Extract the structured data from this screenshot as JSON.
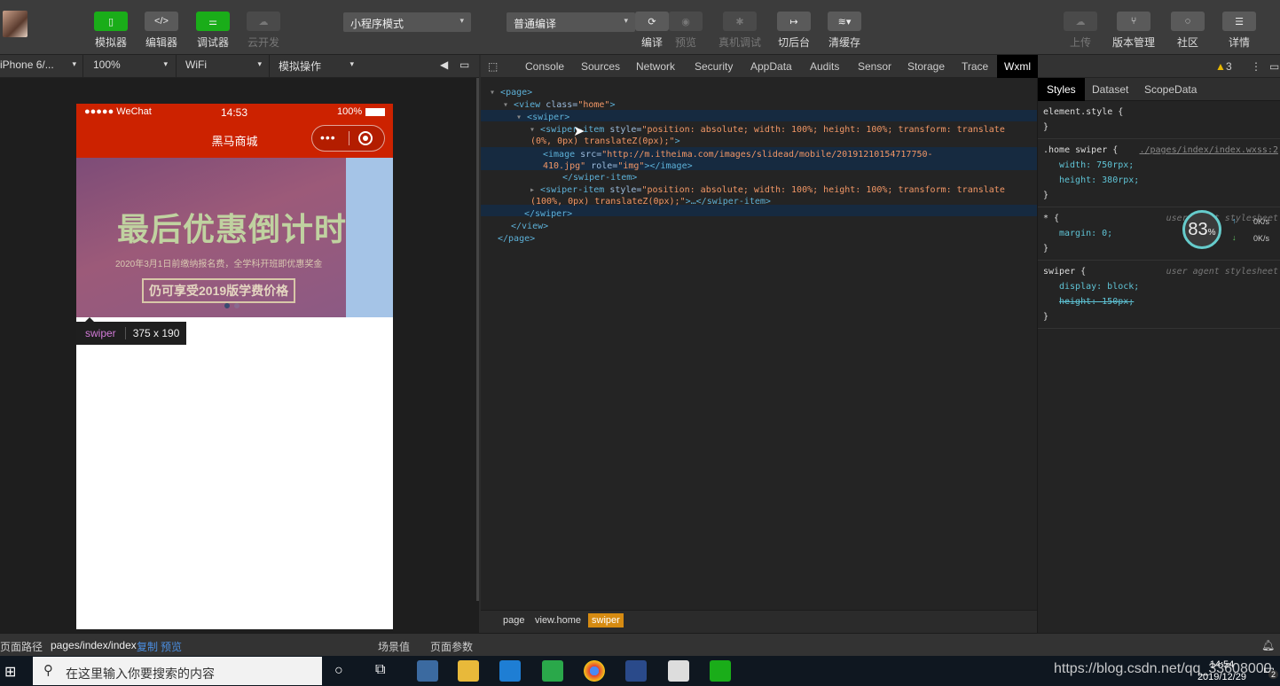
{
  "toolbar": {
    "left_buttons": [
      "模拟器",
      "编辑器",
      "调试器",
      "云开发"
    ],
    "mode_select": "小程序模式",
    "compile_select": "普通编译",
    "mid_buttons": [
      "编译",
      "预览",
      "真机调试",
      "切后台",
      "清缓存"
    ],
    "right_buttons": [
      "上传",
      "版本管理",
      "社区",
      "详情"
    ]
  },
  "simbar": {
    "device": "iPhone 6/...",
    "zoom": "100%",
    "network": "WiFi",
    "operation": "模拟操作"
  },
  "phone": {
    "carrier": "●●●●● WeChat",
    "time": "14:53",
    "battery": "100%",
    "title": "黑马商城",
    "banner_title": "最后优惠倒计时",
    "banner_sub": "2020年3月1日前缴纳报名费，全学科开班即优惠奖金",
    "banner_badge": "仍可享受2019版学费价格"
  },
  "tooltip": {
    "tag": "swiper",
    "size": "375 x 190"
  },
  "devtools": {
    "tabs": [
      "Console",
      "Sources",
      "Network",
      "Security",
      "AppData",
      "Audits",
      "Sensor",
      "Storage",
      "Trace",
      "Wxml"
    ],
    "active_tab": "Wxml",
    "warnings": "3",
    "dom": {
      "l1": "<page>",
      "l2_tag": "<view",
      "l2_attr": "class=",
      "l2_val": "\"home\"",
      "l2_end": ">",
      "l3": "<swiper>",
      "l4_tag": "<swiper-item",
      "l4_attr": "style=",
      "l4_val": "\"position: absolute; width: 100%; height: 100%; transform: translate",
      "l4b": "(0%, 0px) translateZ(0px);\"",
      "l4b_end": ">",
      "l5_tag": "<image",
      "l5_attr": "src=",
      "l5_val": "\"http://m.itheima.com/images/slidead/mobile/20191210154717750-",
      "l5b_val": "410.jpg\"",
      "l5b_attr": "role=",
      "l5b_role": "\"img\"",
      "l5b_end": "></image>",
      "l6": "</swiper-item>",
      "l7_tag": "<swiper-item",
      "l7_attr": "style=",
      "l7_val": "\"position: absolute; width: 100%; height: 100%; transform: translate",
      "l7b": "(100%, 0px) translateZ(0px);\"",
      "l7b_end": ">…</swiper-item>",
      "l8": "</swiper>",
      "l9": "</view>",
      "l10": "</page>"
    },
    "crumbs": [
      "page",
      "view.home",
      "swiper"
    ]
  },
  "styles": {
    "tabs": [
      "Styles",
      "Dataset",
      "ScopeData"
    ],
    "r1_sel": "element.style {",
    "r1_end": "}",
    "r2_sel": ".home swiper {",
    "r2_src": "./pages/index/index.wxss:2",
    "r2_p1": "width: 750rpx;",
    "r2_p2": "height: 380rpx;",
    "r3_sel": "* {",
    "r3_src": "user agent stylesheet",
    "r3_p1": "margin: 0;",
    "r4_sel": "swiper {",
    "r4_src": "user agent stylesheet",
    "r4_p1": "display: block;",
    "r4_p2": "height: 150px;",
    "close": "}"
  },
  "gauge": {
    "value": "83",
    "unit": "%",
    "up": "0K/s",
    "down": "0K/s"
  },
  "footer": {
    "path_label": "页面路径",
    "path": "pages/index/index",
    "copy": "复制",
    "preview": "预览",
    "scene": "场景值",
    "params": "页面参数"
  },
  "taskbar": {
    "search_placeholder": "在这里输入你要搜索的内容",
    "time": "14:54",
    "date": "2019/12/29",
    "notification_count": "2"
  },
  "watermark": "https://blog.csdn.net/qq_33608000"
}
